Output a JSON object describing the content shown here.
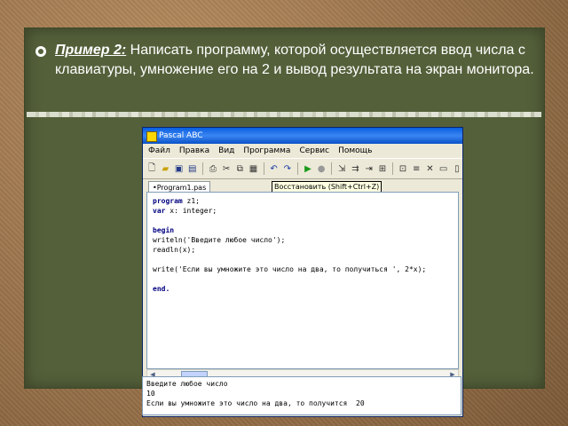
{
  "slide": {
    "bullet_label": "Пример 2:",
    "bullet_text": " Написать программу, которой осуществляется ввод числа с клавиатуры, умножение его на 2 и вывод результата на экран монитора."
  },
  "window": {
    "title": "Pascal ABC",
    "menu": [
      "Файл",
      "Правка",
      "Вид",
      "Программа",
      "Сервис",
      "Помощь"
    ],
    "tab": "•Program1.pas",
    "tooltip": "Восстановить (Shift+Ctrl+Z)"
  },
  "toolbar": {
    "icons": [
      "new-file-icon",
      "open-folder-icon",
      "save-icon",
      "save-all-icon",
      "print-icon",
      "cut-icon",
      "copy-icon",
      "paste-icon",
      "undo-icon",
      "redo-icon",
      "run-icon",
      "stop-icon",
      "step-into-icon",
      "step-over-icon",
      "run-to-cursor-icon",
      "compile-icon",
      "watch-icon",
      "breakpoint-icon",
      "close-icon",
      "window-icon",
      "window2-icon"
    ]
  },
  "editor": {
    "lines": [
      {
        "kw": "program",
        "rest": " z1;"
      },
      {
        "kw": "var",
        "rest": " x: integer;"
      },
      {
        "kw": "",
        "rest": ""
      },
      {
        "kw": "begin",
        "rest": ""
      },
      {
        "kw": "",
        "rest": "writeln('Введите любое число');"
      },
      {
        "kw": "",
        "rest": "readln(x);"
      },
      {
        "kw": "",
        "rest": ""
      },
      {
        "kw": "",
        "rest": "write('Если вы умножите это число на два, то получиться ', 2*x);"
      },
      {
        "kw": "",
        "rest": ""
      },
      {
        "kw": "end.",
        "rest": ""
      }
    ]
  },
  "output": {
    "lines": [
      "Введите любое число",
      "10",
      "Если вы умножите это число на два, то получится  20"
    ]
  }
}
